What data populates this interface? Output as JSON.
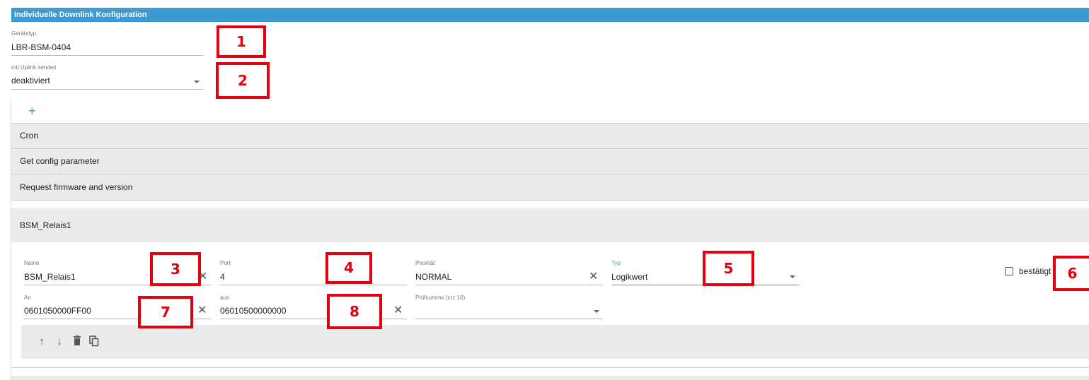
{
  "header": {
    "title": "Individuelle Downlink Konfiguration"
  },
  "device_type": {
    "label": "Gerätetyp",
    "value": "LBR-BSM-0404"
  },
  "uplink": {
    "label": "mit Uplink senden",
    "value": "deaktiviert"
  },
  "add": {
    "icon": "+"
  },
  "list": {
    "items": [
      {
        "label": "Cron"
      },
      {
        "label": "Get config parameter"
      },
      {
        "label": "Request firmware and version"
      }
    ]
  },
  "expanded": {
    "title": "BSM_Relais1",
    "name": {
      "label": "Name",
      "value": "BSM_Relais1"
    },
    "port": {
      "label": "Port",
      "value": "4"
    },
    "priority": {
      "label": "Priorität",
      "value": "NORMAL"
    },
    "type": {
      "label": "Typ",
      "value": "Logikwert"
    },
    "confirmed": {
      "label": "bestätigt",
      "checked": false
    },
    "on": {
      "label": "An",
      "value": "0601050000FF00"
    },
    "off": {
      "label": "aus",
      "value": "06010500000000"
    },
    "checksum": {
      "label": "Prüfsumme (crc 16)",
      "value": ""
    }
  },
  "icons": {
    "clear": "✕",
    "up": "↑",
    "down": "↓",
    "delete": "🗑",
    "copy": "⧉"
  },
  "markers": [
    "1",
    "2",
    "3",
    "4",
    "5",
    "6",
    "7",
    "8"
  ],
  "colors": {
    "accent": "#3d9ad1",
    "marker": "#e3000f"
  }
}
